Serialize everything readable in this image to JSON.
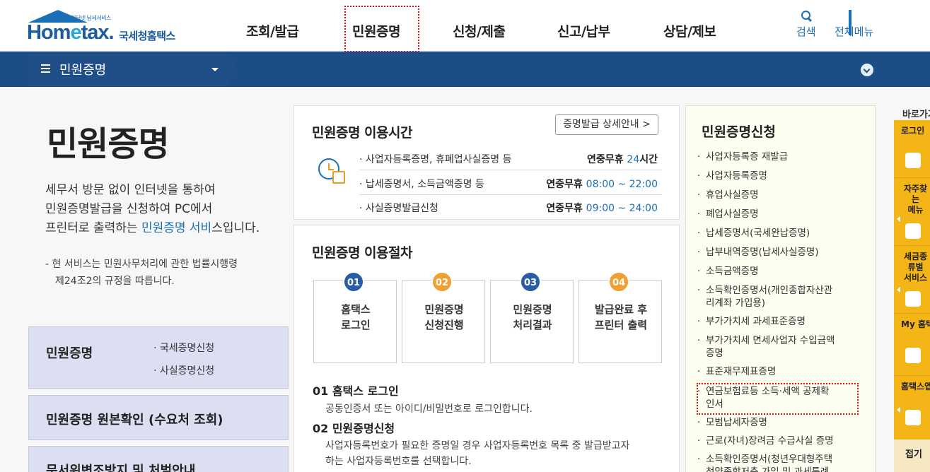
{
  "header": {
    "logo_tag": "인터넷 납세서비스",
    "logo_home": "Hom",
    "logo_e": "e",
    "logo_tax": "tax.",
    "logo_kor": "국세청홈택스",
    "nav": [
      "조회/발급",
      "민원증명",
      "신청/제출",
      "신고/납부",
      "상담/제보"
    ],
    "active_nav": "민원증명",
    "search_label": "검색",
    "menu_label": "전체메뉴"
  },
  "subnav": {
    "title": "민원증명"
  },
  "intro": {
    "title": "민원증명",
    "line1": "세무서 방문 없이 인터넷을 통하여",
    "line2": "민원증명발급을 신청하여 PC에서",
    "line3_pre": "프린터로 출력하는 ",
    "line3_link": "민원증명 서비",
    "line3_post": "스입니다.",
    "note1": "- 현 서비스는 민원사무처리에 관한 법률시행령",
    "note2": "제24조2의 규정을 따릅니다."
  },
  "left_boxes": [
    {
      "title": "민원증명",
      "subs": [
        "· 국세증명신청",
        "· 사실증명신청"
      ]
    },
    {
      "title": "민원증명 원본확인 (수요처 조회)",
      "subs": []
    },
    {
      "title": "문서위변조방지 및 처벌안내",
      "subs": []
    }
  ],
  "usage_time": {
    "title": "민원증명 이용시간",
    "detail_button": "증명발급 상세안내",
    "rows": [
      {
        "label": "· 사업자등록증명, 휴폐업사실증명 등",
        "prefix": "연중무휴 ",
        "value": "24",
        "suffix": "시간"
      },
      {
        "label": "· 납세증명서, 소득금액증명 등",
        "prefix": "연중무휴 ",
        "value": "08:00 ~ 22:00",
        "suffix": ""
      },
      {
        "label": "· 사실증명발급신청",
        "prefix": "연중무휴 ",
        "value": "09:00 ~ 24:00",
        "suffix": ""
      }
    ]
  },
  "procedure": {
    "title": "민원증명 이용절차",
    "steps": [
      {
        "num": "01",
        "line1": "홈택스",
        "line2": "로그인",
        "color": "#2a5da8"
      },
      {
        "num": "02",
        "line1": "민원증명",
        "line2": "신청진행",
        "color": "#f0a030"
      },
      {
        "num": "03",
        "line1": "민원증명",
        "line2": "처리결과",
        "color": "#2a5da8"
      },
      {
        "num": "04",
        "line1": "발급완료 후",
        "line2": "프린터 출력",
        "color": "#f0a030"
      }
    ],
    "step1_head": "01 홈택스 로그인",
    "step1_desc": "공동인증서 또는 아이디/비밀번호로 로그인합니다.",
    "step2_head": "02 민원증명신청",
    "step2_desc1": "사업자등록번호가 필요한 증명일 경우 사업자등록번호 목록 중 발급받고자",
    "step2_desc2": "하는 사업자등록번호를 선택합니다."
  },
  "apply": {
    "title": "민원증명신청",
    "items": [
      "사업자등록증 재발급",
      "사업자등록증명",
      "휴업사실증명",
      "폐업사실증명",
      "납세증명서(국세완납증명)",
      "납부내역증명(납세사실증명)",
      "소득금액증명",
      "소득확인증명서(개인종합자산관",
      "리계좌 가입용)",
      "부가가치세 과세표준증명",
      "부가가치세 면세사업자 수입금액",
      "증명",
      "표준재무제표증명",
      "연금보험료등 소득·세액 공제확",
      "인서",
      "모범납세자증명",
      "근로(자녀)장려금 수급사실 증명",
      "소득확인증명서(청년우대형주택",
      "청약종합저축 가입 및 과세특례"
    ]
  },
  "quick": {
    "title": "바로가기",
    "cells": [
      "로그인",
      "자주찾는\n메뉴",
      "세금종류별\n서비스",
      "My 홈택스",
      "홈택스앱"
    ],
    "bottom": "접기"
  },
  "colors": {
    "brand_blue": "#1a6fb7",
    "subnav": "#1c4d86",
    "quick_yellow": "#f4b516",
    "highlight_red": "#dd1111"
  }
}
